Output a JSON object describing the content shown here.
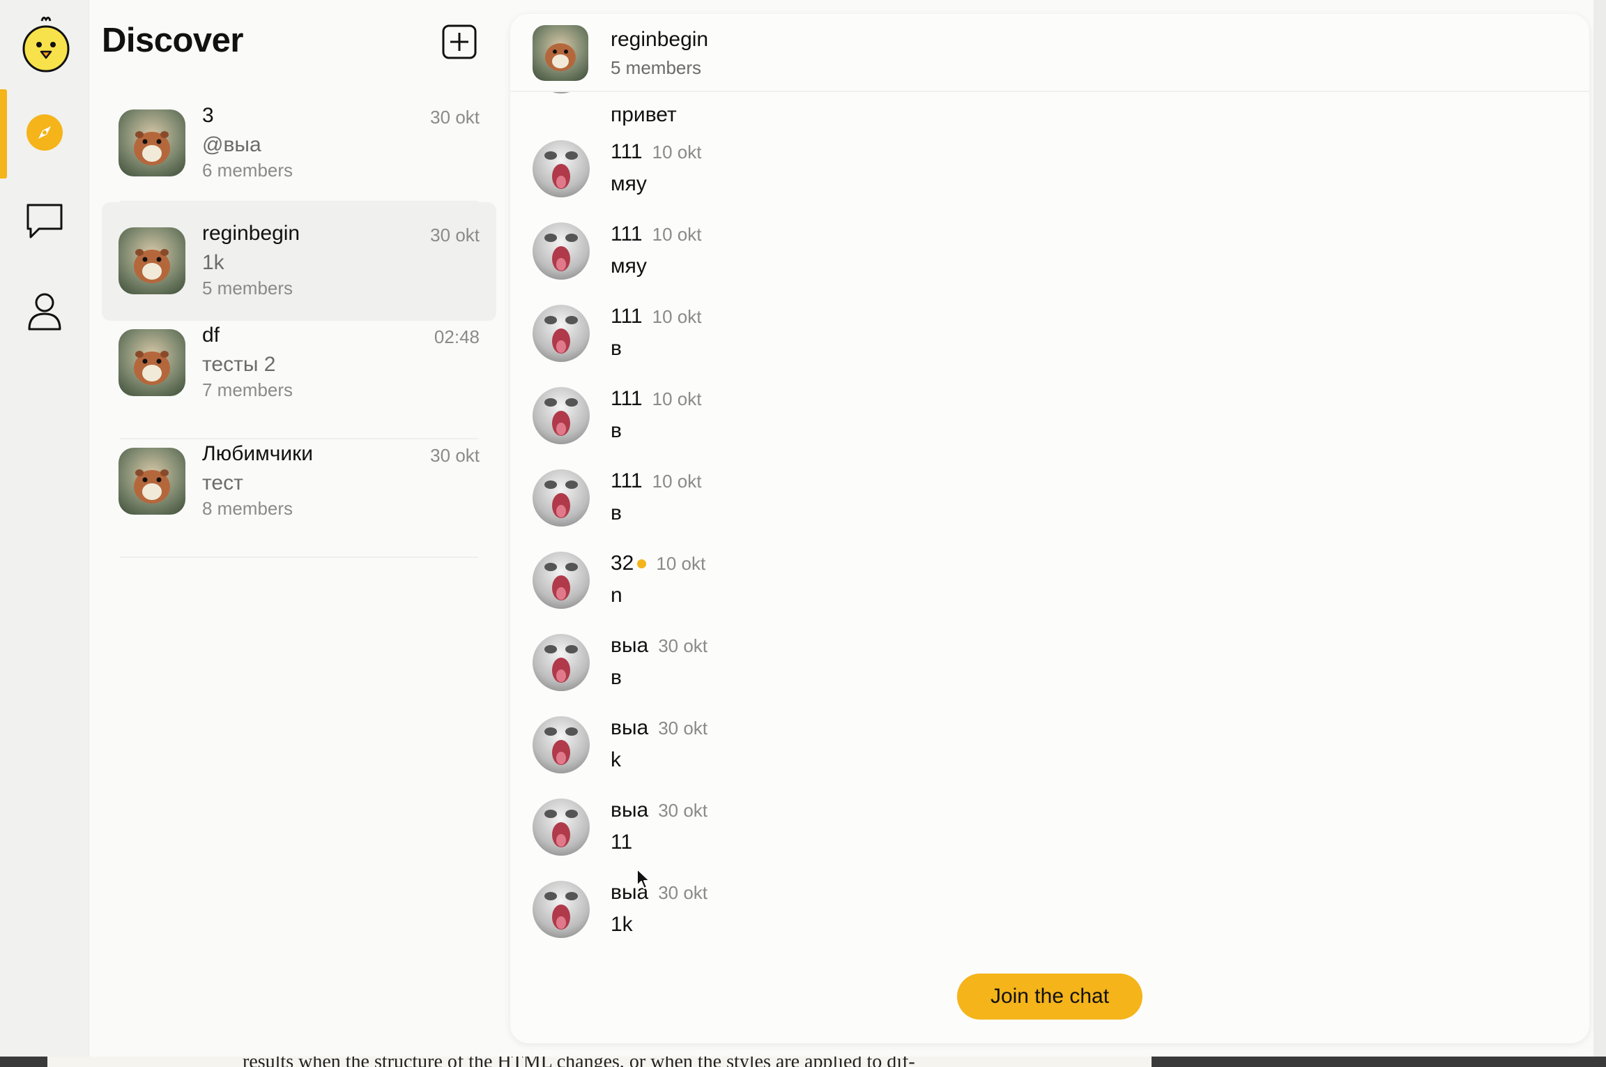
{
  "discover": {
    "title": "Discover",
    "chats": [
      {
        "name": "3",
        "time": "30 okt",
        "preview": "@выа",
        "members": "6 members",
        "active": false
      },
      {
        "name": "reginbegin",
        "time": "30 okt",
        "preview": "1k",
        "members": "5 members",
        "active": true
      },
      {
        "name": "df",
        "time": "02:48",
        "preview": "тесты 2",
        "members": "7 members",
        "active": false
      },
      {
        "name": "Любимчики",
        "time": "30 okt",
        "preview": "тест",
        "members": "8 members",
        "active": false
      }
    ]
  },
  "conversation": {
    "title": "reginbegin",
    "members": "5 members",
    "partial_message": "привет",
    "messages": [
      {
        "author": "111",
        "date": "10 okt",
        "text": "мяу",
        "online": false
      },
      {
        "author": "111",
        "date": "10 okt",
        "text": "мяу",
        "online": false
      },
      {
        "author": "111",
        "date": "10 okt",
        "text": "в",
        "online": false
      },
      {
        "author": "111",
        "date": "10 okt",
        "text": "в",
        "online": false
      },
      {
        "author": "111",
        "date": "10 okt",
        "text": "в",
        "online": false
      },
      {
        "author": "32",
        "date": "10 okt",
        "text": "n",
        "online": true
      },
      {
        "author": "выа",
        "date": "30 okt",
        "text": "в",
        "online": false
      },
      {
        "author": "выа",
        "date": "30 okt",
        "text": "k",
        "online": false
      },
      {
        "author": "выа",
        "date": "30 okt",
        "text": "11",
        "online": false
      },
      {
        "author": "выа",
        "date": "30 okt",
        "text": "1k",
        "online": false
      }
    ],
    "join_label": "Join the chat"
  },
  "nav": {
    "items": [
      {
        "icon": "compass-icon",
        "active": true
      },
      {
        "icon": "chat-bubble-icon",
        "active": false
      },
      {
        "icon": "user-icon",
        "active": false
      }
    ]
  },
  "background_text": "results when the structure of the HTML changes, or when the styles are applied to dif-",
  "colors": {
    "accent": "#f4b41a",
    "muted": "#8a8a88",
    "background": "#fafaf9"
  }
}
